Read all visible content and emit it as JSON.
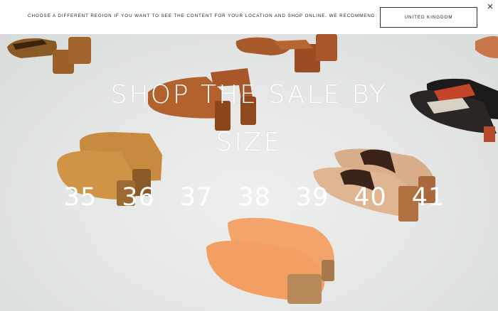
{
  "region_banner": {
    "message": "Choose a different region if you want to see the content for your location and shop online. We recommend:",
    "recommended_region": "United Kingdom",
    "close_icon": "close-icon"
  },
  "hero": {
    "title_line1": "SHOP THE SALE BY",
    "title_line2": "SIZE",
    "sizes": [
      "35",
      "36",
      "37",
      "38",
      "39",
      "40",
      "41"
    ]
  },
  "colors": {
    "banner_bg": "#ffffff",
    "hero_text": "#ffffff",
    "floor": "#e3e6e4"
  }
}
